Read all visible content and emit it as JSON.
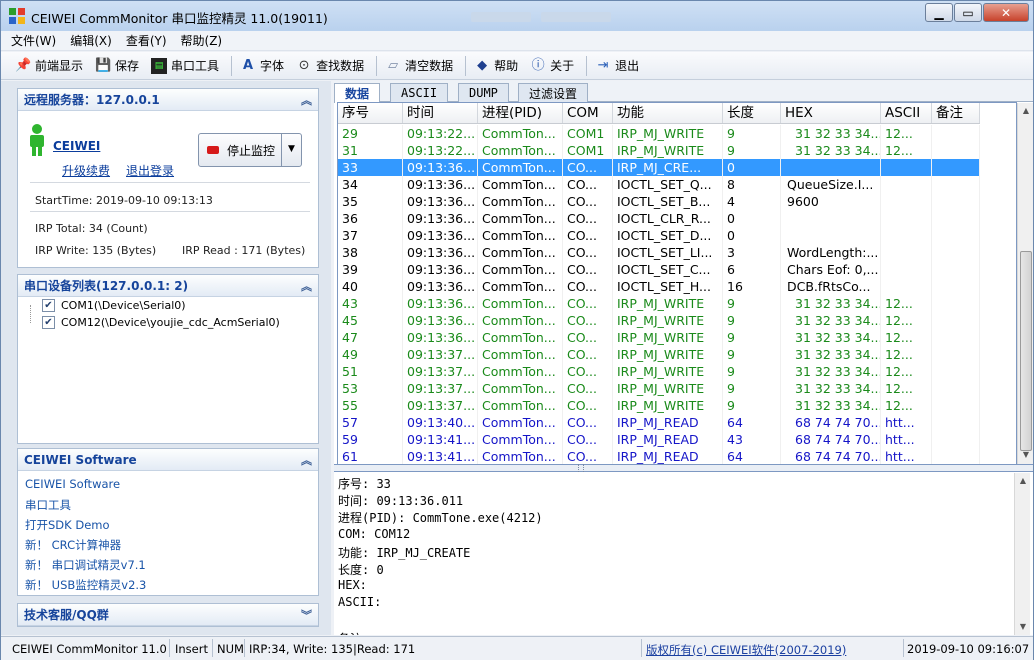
{
  "window": {
    "title": "CEIWEI CommMonitor 串口监控精灵 11.0(19011)",
    "btn_min": "▁",
    "btn_max": "▭",
    "btn_close": "✕"
  },
  "menu": [
    "文件(W)",
    "编辑(X)",
    "查看(Y)",
    "帮助(Z)"
  ],
  "toolbar": [
    {
      "label": "前端显示",
      "icon": "pin-icon"
    },
    {
      "label": "保存",
      "icon": "save-icon"
    },
    {
      "label": "串口工具",
      "icon": "terminal-icon"
    },
    {
      "label": "字体",
      "icon": "font-icon"
    },
    {
      "label": "查找数据",
      "icon": "binoculars-icon"
    },
    {
      "label": "清空数据",
      "icon": "eraser-icon"
    },
    {
      "label": "帮助",
      "icon": "help-book-icon"
    },
    {
      "label": "关于",
      "icon": "info-icon"
    },
    {
      "label": "退出",
      "icon": "exit-icon"
    }
  ],
  "server_panel": {
    "title": "远程服务器：127.0.0.1",
    "name": "CEIWEI",
    "renew": "升级续费",
    "logout": "退出登录",
    "stop_label": "停止监控",
    "start_time": "StartTime: 2019-09-10 09:13:13",
    "irp_total": "IRP Total: 34 (Count)",
    "irp_write": "IRP Write: 135 (Bytes)",
    "irp_read": "IRP Read : 171 (Bytes)"
  },
  "device_panel": {
    "title": "串口设备列表(127.0.0.1: 2)",
    "items": [
      "COM1(\\Device\\Serial0)",
      "COM12(\\Device\\youjie_cdc_AcmSerial0)"
    ]
  },
  "software_panel": {
    "title": "CEIWEI Software",
    "links": [
      "CEIWEI Software",
      "串口工具",
      "打开SDK Demo",
      "新！ CRC计算神器",
      "新！ 串口调试精灵v7.1",
      "新！ USB监控精灵v2.3"
    ]
  },
  "support_panel": {
    "title": "技术客服/QQ群"
  },
  "tabs": [
    "数据",
    "ASCII",
    "DUMP",
    "过滤设置"
  ],
  "columns": [
    "序号",
    "时间",
    "进程(PID)",
    "COM",
    "功能",
    "长度",
    "HEX",
    "ASCII",
    "备注"
  ],
  "row_colors": {
    "green": "#1a8a1a",
    "blue": "#1515c8",
    "black": "#000000",
    "selected_bg": "#3399ff"
  },
  "rows": [
    {
      "c": "green",
      "v": [
        "29",
        "09:13:22...",
        "CommTon...",
        "COM1",
        "IRP_MJ_WRITE",
        "9",
        "31 32 33 34...",
        "12...",
        ""
      ]
    },
    {
      "c": "green",
      "v": [
        "31",
        "09:13:22...",
        "CommTon...",
        "COM1",
        "IRP_MJ_WRITE",
        "9",
        "31 32 33 34...",
        "12...",
        ""
      ]
    },
    {
      "c": "sel",
      "v": [
        "33",
        "09:13:36...",
        "CommTon...",
        "CO...",
        "IRP_MJ_CRE...",
        "0",
        "",
        "",
        ""
      ]
    },
    {
      "c": "black",
      "v": [
        "34",
        "09:13:36...",
        "CommTon...",
        "CO...",
        "IOCTL_SET_Q...",
        "8",
        "QueueSize.I...",
        "",
        ""
      ]
    },
    {
      "c": "black",
      "v": [
        "35",
        "09:13:36...",
        "CommTon...",
        "CO...",
        "IOCTL_SET_B...",
        "4",
        "9600",
        "",
        ""
      ]
    },
    {
      "c": "black",
      "v": [
        "36",
        "09:13:36...",
        "CommTon...",
        "CO...",
        "IOCTL_CLR_R...",
        "0",
        "",
        "",
        ""
      ]
    },
    {
      "c": "black",
      "v": [
        "37",
        "09:13:36...",
        "CommTon...",
        "CO...",
        "IOCTL_SET_D...",
        "0",
        "",
        "",
        ""
      ]
    },
    {
      "c": "black",
      "v": [
        "38",
        "09:13:36...",
        "CommTon...",
        "CO...",
        "IOCTL_SET_LI...",
        "3",
        "WordLength:...",
        "",
        ""
      ]
    },
    {
      "c": "black",
      "v": [
        "39",
        "09:13:36...",
        "CommTon...",
        "CO...",
        "IOCTL_SET_C...",
        "6",
        "Chars Eof: 0,...",
        "",
        ""
      ]
    },
    {
      "c": "black",
      "v": [
        "40",
        "09:13:36...",
        "CommTon...",
        "CO...",
        "IOCTL_SET_H...",
        "16",
        "DCB.fRtsCo...",
        "",
        ""
      ]
    },
    {
      "c": "green",
      "v": [
        "43",
        "09:13:36...",
        "CommTon...",
        "CO...",
        "IRP_MJ_WRITE",
        "9",
        "31 32 33 34...",
        "12...",
        ""
      ]
    },
    {
      "c": "green",
      "v": [
        "45",
        "09:13:36...",
        "CommTon...",
        "CO...",
        "IRP_MJ_WRITE",
        "9",
        "31 32 33 34...",
        "12...",
        ""
      ]
    },
    {
      "c": "green",
      "v": [
        "47",
        "09:13:36...",
        "CommTon...",
        "CO...",
        "IRP_MJ_WRITE",
        "9",
        "31 32 33 34...",
        "12...",
        ""
      ]
    },
    {
      "c": "green",
      "v": [
        "49",
        "09:13:37...",
        "CommTon...",
        "CO...",
        "IRP_MJ_WRITE",
        "9",
        "31 32 33 34...",
        "12...",
        ""
      ]
    },
    {
      "c": "green",
      "v": [
        "51",
        "09:13:37...",
        "CommTon...",
        "CO...",
        "IRP_MJ_WRITE",
        "9",
        "31 32 33 34...",
        "12...",
        ""
      ]
    },
    {
      "c": "green",
      "v": [
        "53",
        "09:13:37...",
        "CommTon...",
        "CO...",
        "IRP_MJ_WRITE",
        "9",
        "31 32 33 34...",
        "12...",
        ""
      ]
    },
    {
      "c": "green",
      "v": [
        "55",
        "09:13:37...",
        "CommTon...",
        "CO...",
        "IRP_MJ_WRITE",
        "9",
        "31 32 33 34...",
        "12...",
        ""
      ]
    },
    {
      "c": "blue",
      "v": [
        "57",
        "09:13:40...",
        "CommTon...",
        "CO...",
        "IRP_MJ_READ",
        "64",
        "68 74 74 70...",
        "htt...",
        ""
      ]
    },
    {
      "c": "blue",
      "v": [
        "59",
        "09:13:41...",
        "CommTon...",
        "CO...",
        "IRP_MJ_READ",
        "43",
        "68 74 74 70...",
        "htt...",
        ""
      ]
    },
    {
      "c": "blue",
      "v": [
        "61",
        "09:13:41...",
        "CommTon...",
        "CO...",
        "IRP_MJ_READ",
        "64",
        "68 74 74 70...",
        "htt...",
        ""
      ]
    }
  ],
  "detail": [
    "序号: 33",
    "时间: 09:13:36.011",
    "进程(PID): CommTone.exe(4212)",
    "COM: COM12",
    "功能: IRP_MJ_CREATE",
    "长度: 0",
    "HEX:",
    "ASCII:",
    "",
    "备注:"
  ],
  "status": {
    "app": "CEIWEI CommMonitor 11.0",
    "insert": "Insert",
    "num": "NUM",
    "irp": "IRP:34, Write: 135|Read: 171",
    "copyright": "版权所有(c) CEIWEI软件(2007-2019)",
    "datetime": "2019-09-10 09:16:07"
  }
}
